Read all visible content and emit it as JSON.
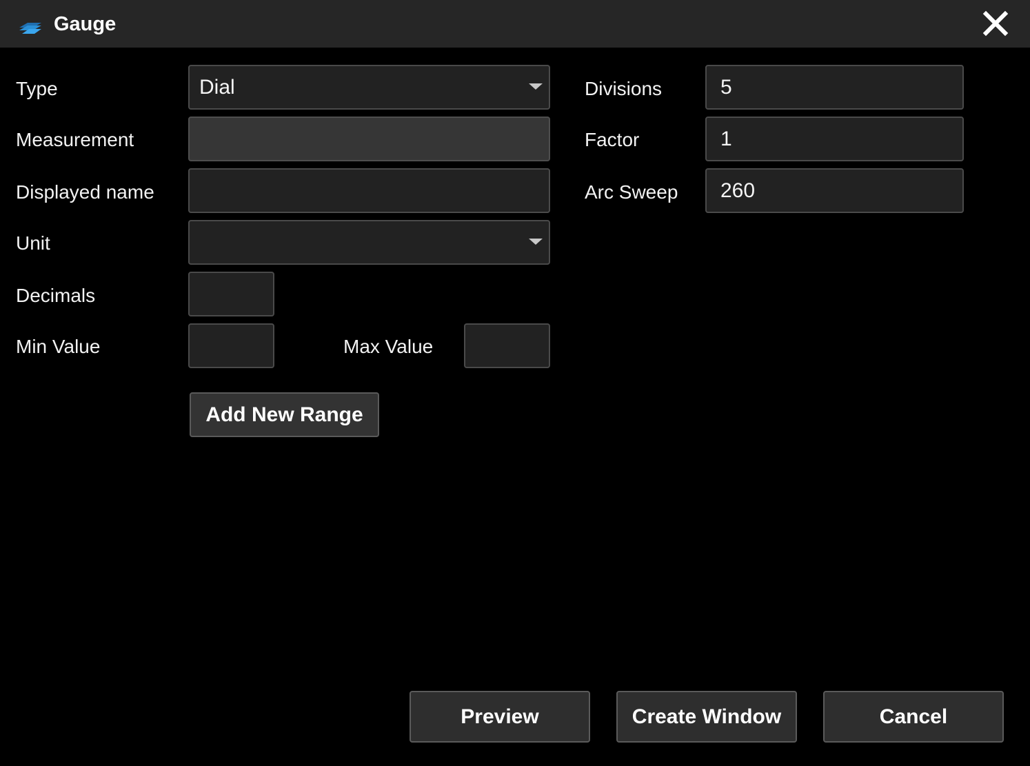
{
  "window": {
    "title": "Gauge",
    "app_icon": "gauge-app-icon",
    "close_icon": "close-icon"
  },
  "form": {
    "type": {
      "label": "Type",
      "value": "Dial"
    },
    "measurement": {
      "label": "Measurement",
      "value": ""
    },
    "displayed_name": {
      "label": "Displayed name",
      "value": ""
    },
    "unit": {
      "label": "Unit",
      "value": ""
    },
    "decimals": {
      "label": "Decimals",
      "value": ""
    },
    "min_value": {
      "label": "Min Value",
      "value": ""
    },
    "max_value": {
      "label": "Max Value",
      "value": ""
    },
    "divisions": {
      "label": "Divisions",
      "value": "5"
    },
    "factor": {
      "label": "Factor",
      "value": "1"
    },
    "arc_sweep": {
      "label": "Arc Sweep",
      "value": "260"
    },
    "add_range_label": "Add New Range"
  },
  "footer": {
    "preview_label": "Preview",
    "create_window_label": "Create Window",
    "cancel_label": "Cancel"
  },
  "colors": {
    "titlebar": "#262626",
    "background": "#000000",
    "field": "#222222",
    "field_disabled": "#363636",
    "icon_blue": "#2a8fd6"
  }
}
